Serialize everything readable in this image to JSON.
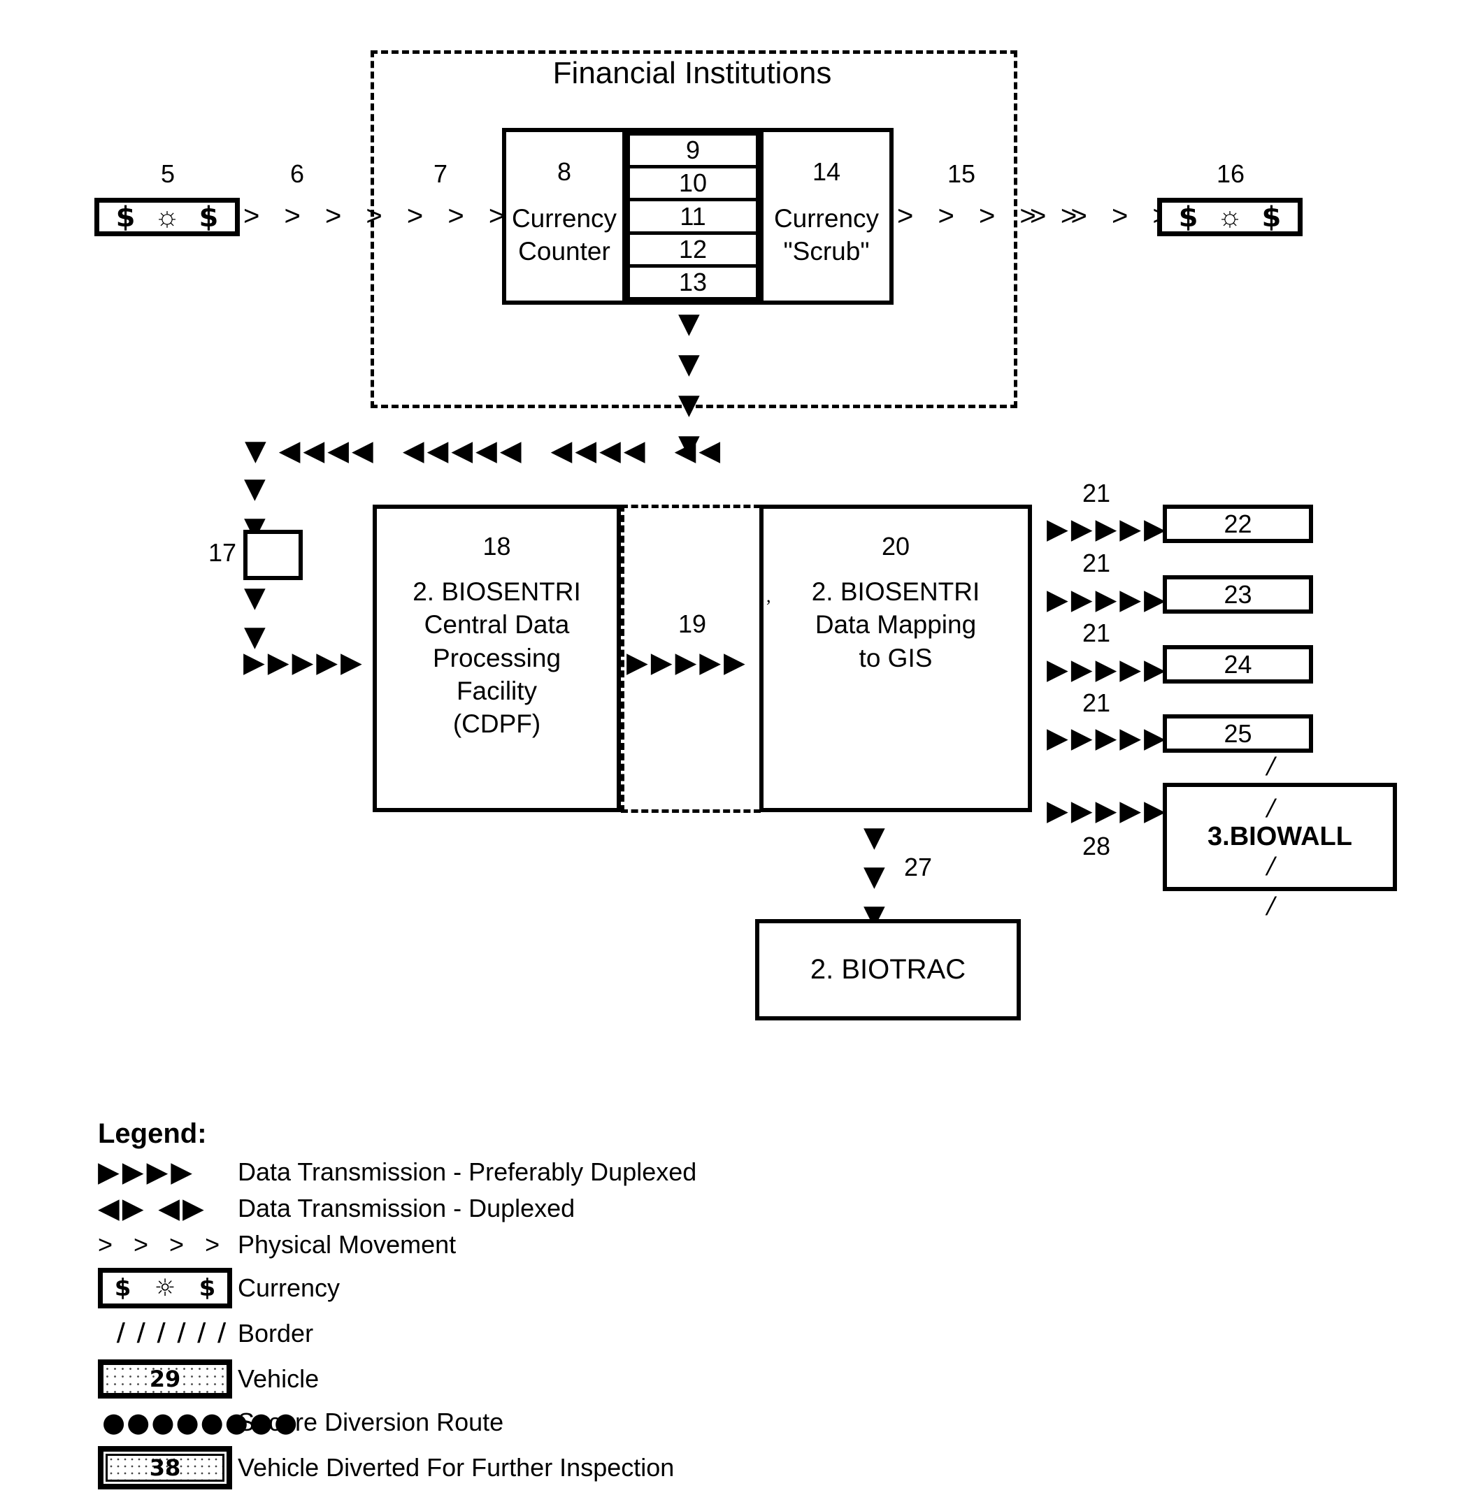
{
  "diagram": {
    "title": "Financial Institutions",
    "top_flow": {
      "source_currency": {
        "ref": "5",
        "symbols": "$ ☼ $"
      },
      "ref_6": "6",
      "ref_7": "7",
      "counter": {
        "ref": "8",
        "line1": "Currency",
        "line2": "Counter"
      },
      "middle_stack": [
        "9",
        "10",
        "11",
        "12",
        "13"
      ],
      "scrub": {
        "ref": "14",
        "line1": "Currency",
        "line2": "\"Scrub\""
      },
      "ref_15": "15",
      "dest_currency": {
        "ref": "16",
        "symbols": "$ ☼ $"
      }
    },
    "mid_flow": {
      "node_17": "17",
      "cdpf": {
        "ref": "18",
        "line1": "2. BIOSENTRI",
        "line2": "Central Data",
        "line3": "Processing",
        "line4": "Facility",
        "line5": "(CDPF)"
      },
      "link_19": "19",
      "gis": {
        "ref": "20",
        "line1": "2. BIOSENTRI",
        "line2": "Data Mapping",
        "line3": "to  GIS"
      },
      "link_27": "27",
      "biotrac": {
        "label": "2. BIOTRAC"
      }
    },
    "right_column": {
      "link_label": "21",
      "boxes": [
        "22",
        "23",
        "24",
        "25"
      ],
      "link_28": "28",
      "biowall": {
        "label": "3.BIOWALL"
      }
    }
  },
  "legend": {
    "title": "Legend:",
    "rows": [
      {
        "key": "▶▶▶▶",
        "text": "Data Transmission - Preferably Duplexed"
      },
      {
        "key": "◀▶ ◀▶",
        "text": "Data Transmission - Duplexed"
      },
      {
        "key": "> > > >",
        "text": "Physical Movement"
      },
      {
        "key": "$ ☼ $",
        "text": "Currency"
      },
      {
        "key": "/ / / / / /",
        "text": "Border"
      },
      {
        "key": "29",
        "text": "Vehicle"
      },
      {
        "key": "●●●●●●●●",
        "text": "Secure Diversion Route"
      },
      {
        "key": "38",
        "text": "Vehicle Diverted For Further Inspection"
      }
    ]
  }
}
